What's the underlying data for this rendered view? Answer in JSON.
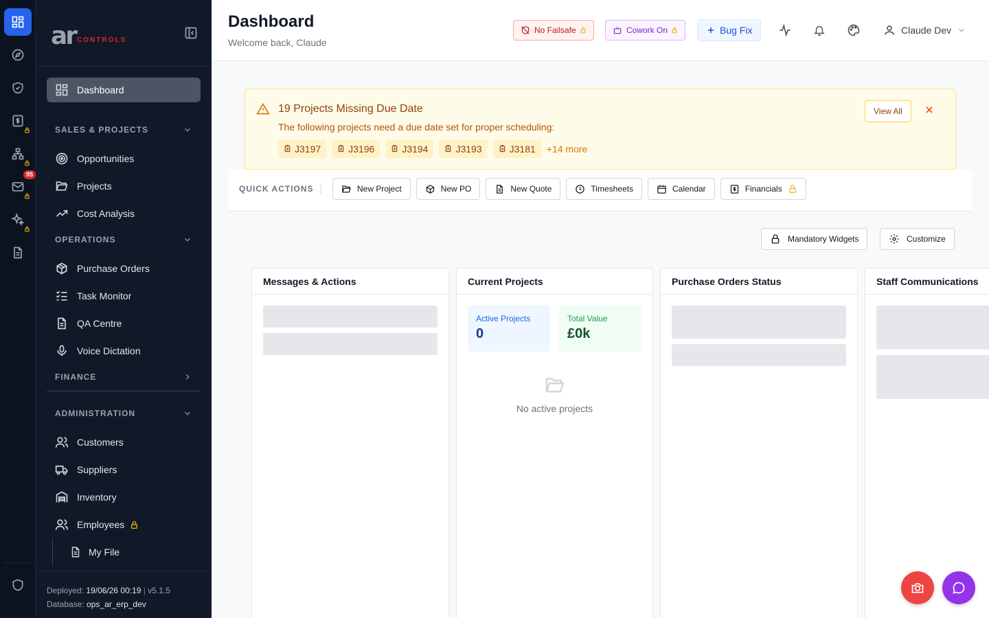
{
  "rail": {
    "badge_count": "95"
  },
  "sidebar": {
    "logo_text": "ar",
    "logo_sub": "CONTROLS",
    "dashboard": "Dashboard",
    "sections": {
      "sales": "SALES & PROJECTS",
      "operations": "OPERATIONS",
      "finance": "FINANCE",
      "administration": "ADMINISTRATION"
    },
    "items": {
      "opportunities": "Opportunities",
      "projects": "Projects",
      "cost_analysis": "Cost Analysis",
      "purchase_orders": "Purchase Orders",
      "task_monitor": "Task Monitor",
      "qa_centre": "QA Centre",
      "voice_dictation": "Voice Dictation",
      "customers": "Customers",
      "suppliers": "Suppliers",
      "inventory": "Inventory",
      "employees": "Employees",
      "my_file": "My File"
    },
    "footer": {
      "deployed_label": "Deployed:",
      "deployed_value": "19/06/26 00:19",
      "sep": "|",
      "version": "v5.1.5",
      "db_label": "Database:",
      "db_value": "ops_ar_erp_dev"
    }
  },
  "header": {
    "title": "Dashboard",
    "subtitle": "Welcome back, Claude",
    "chips": {
      "failsafe": "No Failsafe",
      "cowork": "Cowork On",
      "bugfix": "Bug Fix"
    },
    "user": "Claude Dev"
  },
  "alert": {
    "title": "19 Projects Missing Due Date",
    "text": "The following projects need a due date set for proper scheduling:",
    "tags": [
      "J3197",
      "J3196",
      "J3194",
      "J3193",
      "J3181"
    ],
    "more": "+14 more",
    "view_all": "View All"
  },
  "quick_actions": {
    "label": "QUICK ACTIONS",
    "new_project": "New Project",
    "new_po": "New PO",
    "new_quote": "New Quote",
    "timesheets": "Timesheets",
    "calendar": "Calendar",
    "financials": "Financials"
  },
  "toolbar": {
    "mandatory": "Mandatory Widgets",
    "customize": "Customize"
  },
  "widgets": {
    "messages": "Messages & Actions",
    "current_projects": "Current Projects",
    "po_status": "Purchase Orders Status",
    "staff": "Staff Communications",
    "active_label": "Active Projects",
    "active_value": "0",
    "total_label": "Total Value",
    "total_value": "£0k",
    "empty_text": "No active projects"
  }
}
